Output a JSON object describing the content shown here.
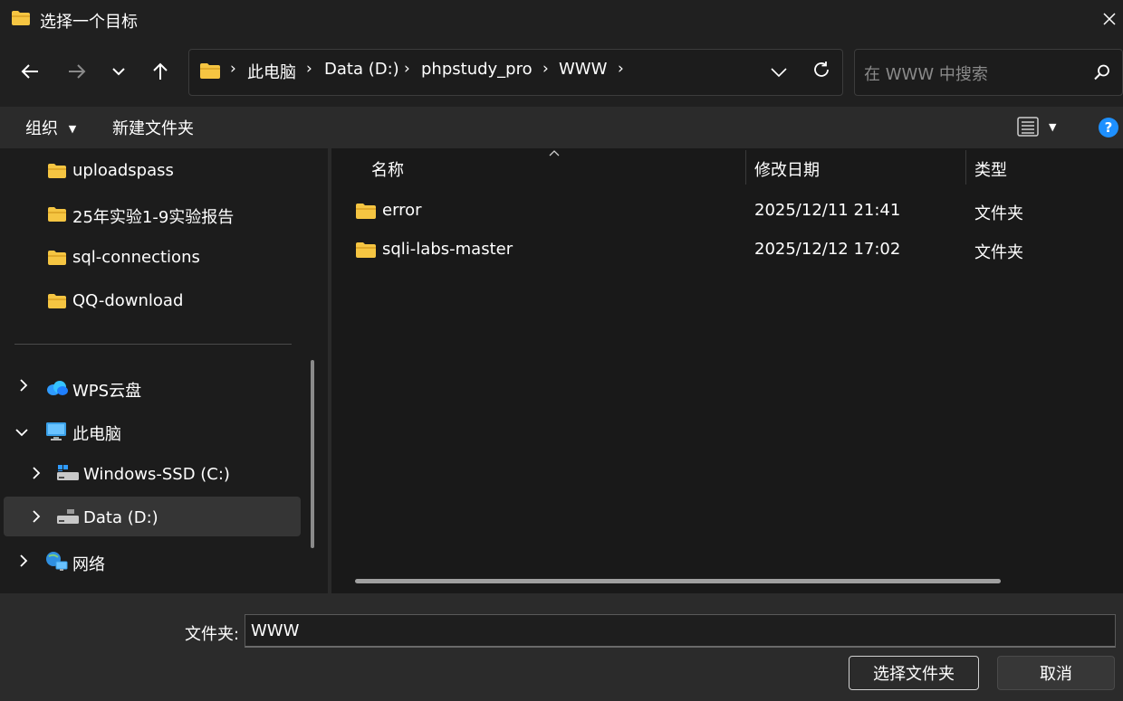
{
  "window": {
    "title": "选择一个目标"
  },
  "address": {
    "crumbs": [
      "此电脑",
      "Data (D:)",
      "phpstudy_pro",
      "WWW"
    ]
  },
  "search": {
    "placeholder": "在 WWW 中搜索"
  },
  "commands": {
    "organize": "组织",
    "new_folder": "新建文件夹"
  },
  "sidebar": {
    "folders": [
      "uploadspass",
      "25年实验1-9实验报告",
      "sql-connections",
      "QQ-download"
    ],
    "nav": [
      {
        "label": "WPS云盘",
        "expanded": false
      },
      {
        "label": "此电脑",
        "expanded": true
      },
      {
        "label": "Windows-SSD (C:)",
        "expanded": false
      },
      {
        "label": "Data (D:)",
        "expanded": false,
        "selected": true
      },
      {
        "label": "网络",
        "expanded": false
      }
    ]
  },
  "columns": {
    "name": "名称",
    "modified": "修改日期",
    "type": "类型"
  },
  "files": [
    {
      "name": "error",
      "modified": "2025/12/11 21:41",
      "type": "文件夹"
    },
    {
      "name": "sqli-labs-master",
      "modified": "2025/12/12 17:02",
      "type": "文件夹"
    }
  ],
  "footer": {
    "folder_label": "文件夹:",
    "folder_value": "WWW",
    "select_button": "选择文件夹",
    "cancel_button": "取消"
  },
  "colors": {
    "folder": "#f5c542",
    "accent": "#0078d4",
    "help": "#1e90ff"
  }
}
